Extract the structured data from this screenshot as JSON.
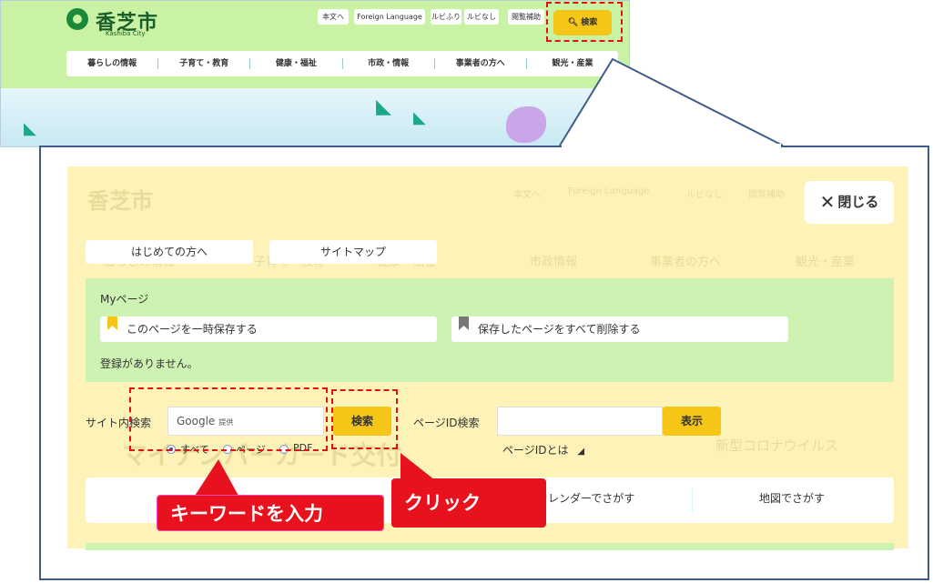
{
  "site": {
    "logo_text": "香芝市",
    "logo_sub": "Kashiba City",
    "util_links": [
      "本文へ",
      "Foreign Language",
      "ルビふり",
      "ルビなし",
      "閲覧補助"
    ],
    "search_label": "検索",
    "nav": [
      "暮らしの情報",
      "子育て・教育",
      "健康・福祉",
      "市政・情報",
      "事業者の方へ",
      "観光・産業"
    ]
  },
  "panel": {
    "close_label": "閉じる",
    "tabs": [
      "はじめての方へ",
      "サイトマップ"
    ],
    "ghost_nav": [
      "暮らしの情報",
      "子育て・教育",
      "健康・福祉",
      "市政情報",
      "事業者の方へ",
      "観光・産業"
    ],
    "ghost_util": [
      "本文へ",
      "Foreign Language",
      "ルビなし",
      "閲覧補助"
    ],
    "my_title": "Myページ",
    "save_temp": "このページを一時保存する",
    "delete_all": "保存したページをすべて削除する",
    "my_empty": "登録がありません。",
    "site_search_label": "サイト内検索",
    "google_placeholder": "Google",
    "google_suffix": "提供",
    "search_button": "検索",
    "page_id_label": "ページID検索",
    "show_button": "表示",
    "radio_options": [
      "すべて",
      "ページ",
      "PDF"
    ],
    "page_id_help": "ページIDとは",
    "find_items": [
      "カレンダーでさがす",
      "地図でさがす"
    ],
    "ghost_banner": "マイナンバーカード交付",
    "ghost_corona": "新型コロナウイルス"
  },
  "callouts": {
    "keyword": "キーワードを入力",
    "click": "クリック"
  },
  "colors": {
    "header_green": "#c9f2a4",
    "accent_yellow": "#f5c518",
    "callout_red": "#e8121f",
    "panel_border": "#3e5c87"
  }
}
